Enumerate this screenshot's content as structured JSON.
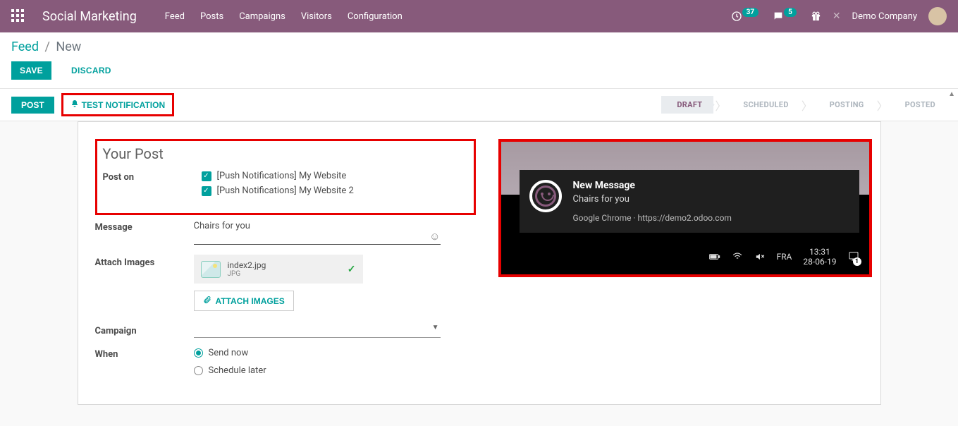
{
  "navbar": {
    "brand": "Social Marketing",
    "menu": [
      "Feed",
      "Posts",
      "Campaigns",
      "Visitors",
      "Configuration"
    ],
    "tray": {
      "timer_badge": "37",
      "chat_badge": "5",
      "company": "Demo Company"
    }
  },
  "breadcrumb": {
    "root": "Feed",
    "leaf": "New"
  },
  "cp": {
    "save": "SAVE",
    "discard": "DISCARD"
  },
  "statusbar": {
    "post": "POST",
    "test": "TEST NOTIFICATION",
    "stages": [
      "DRAFT",
      "SCHEDULED",
      "POSTING",
      "POSTED"
    ]
  },
  "form": {
    "title": "Your Post",
    "labels": {
      "post_on": "Post on",
      "message": "Message",
      "attach": "Attach Images",
      "campaign": "Campaign",
      "when": "When"
    },
    "post_on": [
      "[Push Notifications] My Website",
      "[Push Notifications] My Website 2"
    ],
    "message": "Chairs for you",
    "file": {
      "name": "index2.jpg",
      "type": "JPG"
    },
    "attach_btn": "ATTACH IMAGES",
    "when_opts": {
      "now": "Send now",
      "later": "Schedule later"
    }
  },
  "notif": {
    "title": "New Message",
    "body": "Chairs for you",
    "source": "Google Chrome · https://demo2.odoo.com",
    "taskbar": {
      "lang": "FRA",
      "time": "13:31",
      "date": "28-06-19",
      "action_count": "1"
    }
  }
}
